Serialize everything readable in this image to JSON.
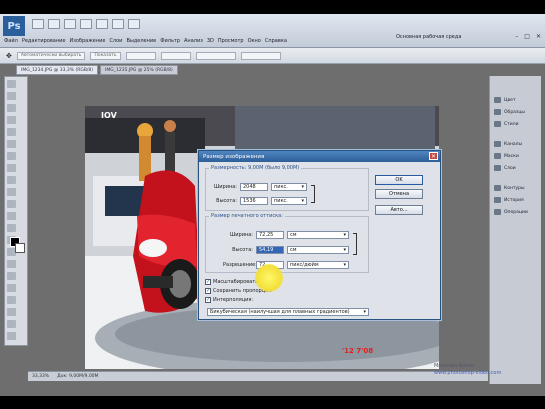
{
  "app": {
    "logo": "Ps",
    "workspace": "Основная рабочая среда"
  },
  "menu": [
    "Файл",
    "Редактирование",
    "Изображение",
    "Слои",
    "Выделение",
    "Фильтр",
    "Анализ",
    "3D",
    "Просмотр",
    "Окно",
    "Справка"
  ],
  "options": {
    "toggle_label": "Автоматически выбирать",
    "mode_label": "Показать"
  },
  "tabs": [
    {
      "label": "IMG_1234.JPG @ 33,3% (RGB/8)",
      "active": true
    },
    {
      "label": "IMG_1235.JPG @ 25% (RGB/8)",
      "active": false
    }
  ],
  "status": {
    "zoom": "33,33%",
    "doc": "Док: 9,00M/9,00M"
  },
  "dock": [
    "Цвет",
    "Образцы",
    "Стили",
    "Каналы",
    "Маски",
    "Слои",
    "Контуры",
    "История",
    "Операции"
  ],
  "watermark": {
    "author": "Михотин Антон",
    "url": "www.photoshop-video.com"
  },
  "photo_text": {
    "brand": "IOV",
    "date": "'12 7'08"
  },
  "dialog": {
    "title": "Размер изображения",
    "dimensions_legend": "Размерность: 9,00M (было 9,00M)",
    "width_label": "Ширина:",
    "width_value": "2048",
    "width_unit": "пикс.",
    "height_label": "Высота:",
    "height_value": "1536",
    "height_unit": "пикс.",
    "print_legend": "Размер печатного оттиска:",
    "p_width_label": "Ширина:",
    "p_width_value": "72,25",
    "p_width_unit": "см",
    "p_height_label": "Высота:",
    "p_height_value": "54,19",
    "p_height_unit": "см",
    "resolution_label": "Разрешение:",
    "resolution_value": "72",
    "resolution_unit": "пикс/дюйм",
    "ok": "OK",
    "cancel": "Отмена",
    "auto": "Авто...",
    "scale_styles": "Масштабировать стили",
    "constrain": "Сохранить пропорции",
    "resample": "Интерполяция:",
    "resample_method": "Бикубическая (наилучшая для плавных градиентов)"
  }
}
